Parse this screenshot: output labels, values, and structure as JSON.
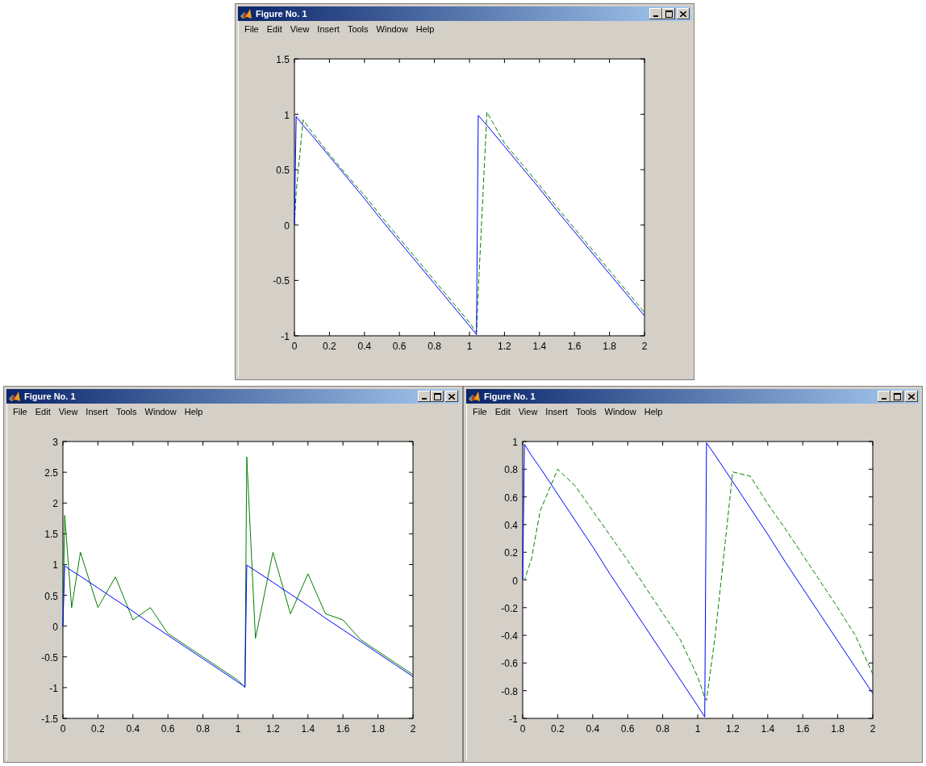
{
  "windows": [
    {
      "title": "Figure No. 1",
      "menu": [
        "File",
        "Edit",
        "View",
        "Insert",
        "Tools",
        "Window",
        "Help"
      ],
      "chart_data": {
        "type": "line",
        "x": [
          0,
          0.01,
          0.05,
          0.1,
          0.2,
          0.3,
          0.4,
          0.5,
          0.6,
          0.7,
          0.8,
          0.9,
          1.0,
          1.04,
          1.05,
          1.1,
          1.2,
          1.3,
          1.4,
          1.5,
          1.6,
          1.7,
          1.8,
          1.9,
          2.0
        ],
        "xlim": [
          0,
          2
        ],
        "ylim": [
          -1,
          1.5
        ],
        "xticks": [
          0,
          0.2,
          0.4,
          0.6,
          0.8,
          1,
          1.2,
          1.4,
          1.6,
          1.8,
          2
        ],
        "yticks": [
          -1,
          -0.5,
          0,
          0.5,
          1,
          1.5
        ],
        "series": [
          {
            "color": "#0000ff",
            "line_style": "solid",
            "values": [
              0,
              0.98,
              0.9,
              0.81,
              0.62,
              0.43,
              0.24,
              0.04,
              -0.15,
              -0.34,
              -0.53,
              -0.72,
              -0.91,
              -0.99,
              0.99,
              0.9,
              0.71,
              0.52,
              0.33,
              0.13,
              -0.06,
              -0.25,
              -0.44,
              -0.63,
              -0.82
            ]
          },
          {
            "color": "#008000",
            "line_style": "dashed",
            "values": [
              0,
              0.3,
              0.95,
              0.84,
              0.64,
              0.45,
              0.27,
              0.07,
              -0.12,
              -0.31,
              -0.5,
              -0.69,
              -0.88,
              -0.97,
              -0.6,
              1.02,
              0.74,
              0.55,
              0.36,
              0.16,
              -0.03,
              -0.22,
              -0.41,
              -0.6,
              -0.79
            ]
          }
        ]
      }
    },
    {
      "title": "Figure No. 1",
      "menu": [
        "File",
        "Edit",
        "View",
        "Insert",
        "Tools",
        "Window",
        "Help"
      ],
      "chart_data": {
        "type": "line",
        "x": [
          0,
          0.01,
          0.05,
          0.1,
          0.2,
          0.3,
          0.4,
          0.5,
          0.6,
          0.7,
          0.8,
          0.9,
          1.0,
          1.04,
          1.05,
          1.1,
          1.2,
          1.3,
          1.4,
          1.5,
          1.6,
          1.7,
          1.8,
          1.9,
          2.0
        ],
        "xlim": [
          0,
          2
        ],
        "ylim": [
          -1.5,
          3
        ],
        "xticks": [
          0,
          0.2,
          0.4,
          0.6,
          0.8,
          1,
          1.2,
          1.4,
          1.6,
          1.8,
          2
        ],
        "yticks": [
          -1.5,
          -1,
          -0.5,
          0,
          0.5,
          1,
          1.5,
          2,
          2.5,
          3
        ],
        "series": [
          {
            "color": "#0000ff",
            "line_style": "solid",
            "values": [
              0,
              0.98,
              0.9,
              0.81,
              0.62,
              0.43,
              0.24,
              0.04,
              -0.15,
              -0.34,
              -0.53,
              -0.72,
              -0.91,
              -0.99,
              0.99,
              0.9,
              0.71,
              0.52,
              0.33,
              0.13,
              -0.06,
              -0.25,
              -0.44,
              -0.63,
              -0.82
            ]
          },
          {
            "color": "#008000",
            "line_style": "solid",
            "values": [
              0,
              1.8,
              0.3,
              1.2,
              0.3,
              0.8,
              0.1,
              0.3,
              -0.12,
              -0.31,
              -0.5,
              -0.69,
              -0.88,
              -1.0,
              2.75,
              -0.2,
              1.2,
              0.2,
              0.85,
              0.2,
              0.1,
              -0.22,
              -0.41,
              -0.6,
              -0.79
            ]
          }
        ]
      }
    },
    {
      "title": "Figure No. 1",
      "menu": [
        "File",
        "Edit",
        "View",
        "Insert",
        "Tools",
        "Window",
        "Help"
      ],
      "chart_data": {
        "type": "line",
        "x": [
          0,
          0.01,
          0.05,
          0.1,
          0.2,
          0.3,
          0.4,
          0.5,
          0.6,
          0.7,
          0.8,
          0.9,
          1.0,
          1.04,
          1.05,
          1.1,
          1.2,
          1.3,
          1.4,
          1.5,
          1.6,
          1.7,
          1.8,
          1.9,
          2.0
        ],
        "xlim": [
          0,
          2
        ],
        "ylim": [
          -1,
          1
        ],
        "xticks": [
          0,
          0.2,
          0.4,
          0.6,
          0.8,
          1,
          1.2,
          1.4,
          1.6,
          1.8,
          2
        ],
        "yticks": [
          -1,
          -0.8,
          -0.6,
          -0.4,
          -0.2,
          0,
          0.2,
          0.4,
          0.6,
          0.8,
          1
        ],
        "series": [
          {
            "color": "#0000ff",
            "line_style": "solid",
            "values": [
              0,
              0.98,
              0.9,
              0.81,
              0.62,
              0.43,
              0.24,
              0.04,
              -0.15,
              -0.34,
              -0.53,
              -0.72,
              -0.91,
              -0.99,
              0.99,
              0.9,
              0.71,
              0.52,
              0.33,
              0.13,
              -0.06,
              -0.25,
              -0.44,
              -0.63,
              -0.82
            ]
          },
          {
            "color": "#008000",
            "line_style": "dashed",
            "values": [
              0,
              0,
              0.15,
              0.5,
              0.8,
              0.68,
              0.5,
              0.32,
              0.14,
              -0.05,
              -0.24,
              -0.43,
              -0.7,
              -0.85,
              -0.87,
              -0.4,
              0.78,
              0.75,
              0.55,
              0.37,
              0.18,
              -0.01,
              -0.2,
              -0.4,
              -0.68
            ]
          }
        ]
      }
    }
  ]
}
